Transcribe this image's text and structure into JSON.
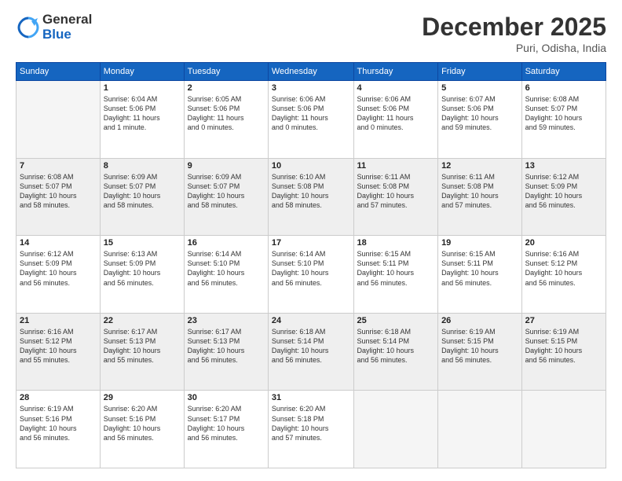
{
  "header": {
    "logo_line1": "General",
    "logo_line2": "Blue",
    "month": "December 2025",
    "location": "Puri, Odisha, India"
  },
  "weekdays": [
    "Sunday",
    "Monday",
    "Tuesday",
    "Wednesday",
    "Thursday",
    "Friday",
    "Saturday"
  ],
  "rows": [
    [
      {
        "day": "",
        "text": ""
      },
      {
        "day": "1",
        "text": "Sunrise: 6:04 AM\nSunset: 5:06 PM\nDaylight: 11 hours\nand 1 minute."
      },
      {
        "day": "2",
        "text": "Sunrise: 6:05 AM\nSunset: 5:06 PM\nDaylight: 11 hours\nand 0 minutes."
      },
      {
        "day": "3",
        "text": "Sunrise: 6:06 AM\nSunset: 5:06 PM\nDaylight: 11 hours\nand 0 minutes."
      },
      {
        "day": "4",
        "text": "Sunrise: 6:06 AM\nSunset: 5:06 PM\nDaylight: 11 hours\nand 0 minutes."
      },
      {
        "day": "5",
        "text": "Sunrise: 6:07 AM\nSunset: 5:06 PM\nDaylight: 10 hours\nand 59 minutes."
      },
      {
        "day": "6",
        "text": "Sunrise: 6:08 AM\nSunset: 5:07 PM\nDaylight: 10 hours\nand 59 minutes."
      }
    ],
    [
      {
        "day": "7",
        "text": "Sunrise: 6:08 AM\nSunset: 5:07 PM\nDaylight: 10 hours\nand 58 minutes."
      },
      {
        "day": "8",
        "text": "Sunrise: 6:09 AM\nSunset: 5:07 PM\nDaylight: 10 hours\nand 58 minutes."
      },
      {
        "day": "9",
        "text": "Sunrise: 6:09 AM\nSunset: 5:07 PM\nDaylight: 10 hours\nand 58 minutes."
      },
      {
        "day": "10",
        "text": "Sunrise: 6:10 AM\nSunset: 5:08 PM\nDaylight: 10 hours\nand 58 minutes."
      },
      {
        "day": "11",
        "text": "Sunrise: 6:11 AM\nSunset: 5:08 PM\nDaylight: 10 hours\nand 57 minutes."
      },
      {
        "day": "12",
        "text": "Sunrise: 6:11 AM\nSunset: 5:08 PM\nDaylight: 10 hours\nand 57 minutes."
      },
      {
        "day": "13",
        "text": "Sunrise: 6:12 AM\nSunset: 5:09 PM\nDaylight: 10 hours\nand 56 minutes."
      }
    ],
    [
      {
        "day": "14",
        "text": "Sunrise: 6:12 AM\nSunset: 5:09 PM\nDaylight: 10 hours\nand 56 minutes."
      },
      {
        "day": "15",
        "text": "Sunrise: 6:13 AM\nSunset: 5:09 PM\nDaylight: 10 hours\nand 56 minutes."
      },
      {
        "day": "16",
        "text": "Sunrise: 6:14 AM\nSunset: 5:10 PM\nDaylight: 10 hours\nand 56 minutes."
      },
      {
        "day": "17",
        "text": "Sunrise: 6:14 AM\nSunset: 5:10 PM\nDaylight: 10 hours\nand 56 minutes."
      },
      {
        "day": "18",
        "text": "Sunrise: 6:15 AM\nSunset: 5:11 PM\nDaylight: 10 hours\nand 56 minutes."
      },
      {
        "day": "19",
        "text": "Sunrise: 6:15 AM\nSunset: 5:11 PM\nDaylight: 10 hours\nand 56 minutes."
      },
      {
        "day": "20",
        "text": "Sunrise: 6:16 AM\nSunset: 5:12 PM\nDaylight: 10 hours\nand 56 minutes."
      }
    ],
    [
      {
        "day": "21",
        "text": "Sunrise: 6:16 AM\nSunset: 5:12 PM\nDaylight: 10 hours\nand 55 minutes."
      },
      {
        "day": "22",
        "text": "Sunrise: 6:17 AM\nSunset: 5:13 PM\nDaylight: 10 hours\nand 55 minutes."
      },
      {
        "day": "23",
        "text": "Sunrise: 6:17 AM\nSunset: 5:13 PM\nDaylight: 10 hours\nand 56 minutes."
      },
      {
        "day": "24",
        "text": "Sunrise: 6:18 AM\nSunset: 5:14 PM\nDaylight: 10 hours\nand 56 minutes."
      },
      {
        "day": "25",
        "text": "Sunrise: 6:18 AM\nSunset: 5:14 PM\nDaylight: 10 hours\nand 56 minutes."
      },
      {
        "day": "26",
        "text": "Sunrise: 6:19 AM\nSunset: 5:15 PM\nDaylight: 10 hours\nand 56 minutes."
      },
      {
        "day": "27",
        "text": "Sunrise: 6:19 AM\nSunset: 5:15 PM\nDaylight: 10 hours\nand 56 minutes."
      }
    ],
    [
      {
        "day": "28",
        "text": "Sunrise: 6:19 AM\nSunset: 5:16 PM\nDaylight: 10 hours\nand 56 minutes."
      },
      {
        "day": "29",
        "text": "Sunrise: 6:20 AM\nSunset: 5:16 PM\nDaylight: 10 hours\nand 56 minutes."
      },
      {
        "day": "30",
        "text": "Sunrise: 6:20 AM\nSunset: 5:17 PM\nDaylight: 10 hours\nand 56 minutes."
      },
      {
        "day": "31",
        "text": "Sunrise: 6:20 AM\nSunset: 5:18 PM\nDaylight: 10 hours\nand 57 minutes."
      },
      {
        "day": "",
        "text": ""
      },
      {
        "day": "",
        "text": ""
      },
      {
        "day": "",
        "text": ""
      }
    ]
  ]
}
